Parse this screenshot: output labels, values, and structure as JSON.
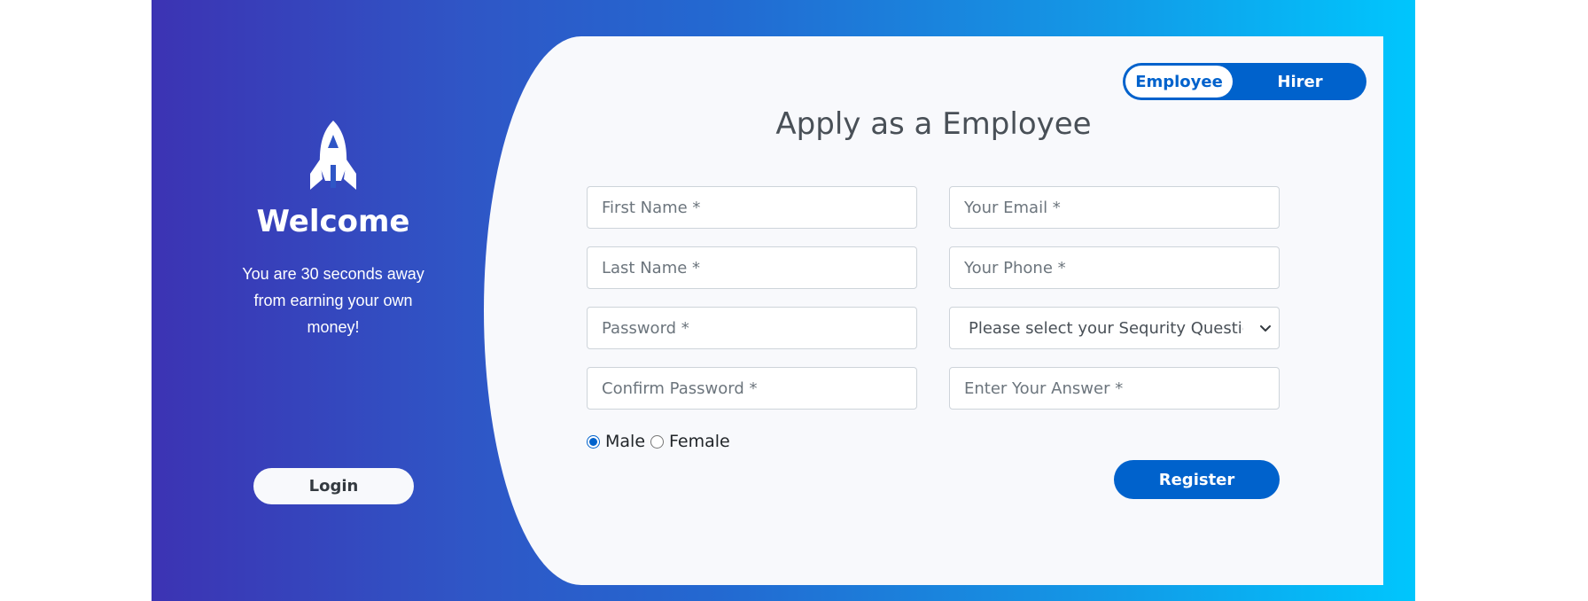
{
  "colors": {
    "gradient_start": "#3c33b3",
    "gradient_end": "#00c6fd",
    "primary": "#0062cc",
    "card_bg": "#f8f9fc"
  },
  "left_panel": {
    "icon": "rocket-icon",
    "heading": "Welcome",
    "tagline": "You are 30 seconds away from earning your own money!",
    "login_label": "Login"
  },
  "toggle": {
    "options": [
      "Employee",
      "Hirer"
    ],
    "active": "Employee"
  },
  "form": {
    "title": "Apply as a Employee",
    "fields": {
      "first_name": {
        "placeholder": "First Name *",
        "value": ""
      },
      "last_name": {
        "placeholder": "Last Name *",
        "value": ""
      },
      "password": {
        "placeholder": "Password *",
        "value": ""
      },
      "confirm_password": {
        "placeholder": "Confirm Password *",
        "value": ""
      },
      "email": {
        "placeholder": "Your Email *",
        "value": ""
      },
      "phone": {
        "placeholder": "Your Phone *",
        "value": ""
      },
      "security_question": {
        "selected": "Please select your Sequrity Question"
      },
      "answer": {
        "placeholder": "Enter Your Answer *",
        "value": ""
      }
    },
    "gender": {
      "options": [
        "Male",
        "Female"
      ],
      "selected": "Male"
    },
    "register_label": "Register"
  }
}
